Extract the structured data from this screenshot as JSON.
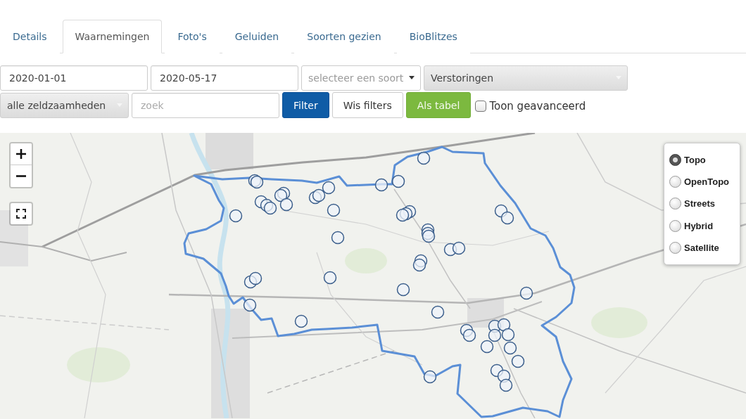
{
  "tabs": [
    {
      "label": "Details",
      "selected": false
    },
    {
      "label": "Waarnemingen",
      "selected": true
    },
    {
      "label": "Foto's",
      "selected": false
    },
    {
      "label": "Geluiden",
      "selected": false
    },
    {
      "label": "Soorten gezien",
      "selected": false
    },
    {
      "label": "BioBlitzes",
      "selected": false
    }
  ],
  "filters": [
    [
      {
        "kind": "date-field",
        "value": "2020-01-01"
      },
      {
        "kind": "date-field",
        "value": "2020-05-17"
      },
      {
        "kind": "select",
        "placeholder": "selecteer een soort"
      },
      {
        "kind": "chosen-select",
        "value": "Verstoringen"
      }
    ],
    [
      {
        "kind": "chosen-select",
        "value": "alle zeldzaamheden"
      },
      {
        "kind": "search-field",
        "placeholder": "zoek"
      },
      {
        "kind": "button",
        "label": "Filter"
      },
      {
        "kind": "button",
        "label": "Wis filters"
      },
      {
        "kind": "button",
        "label": "Als tabel"
      },
      {
        "kind": "checkbox",
        "label": "Toon geavanceerd",
        "checked": false
      }
    ]
  ],
  "map": {
    "layers": [
      {
        "label": "Topo",
        "selected": true
      },
      {
        "label": "OpenTopo",
        "selected": false
      },
      {
        "label": "Streets",
        "selected": false
      },
      {
        "label": "Hybrid",
        "selected": false
      },
      {
        "label": "Satellite",
        "selected": false
      }
    ]
  }
}
